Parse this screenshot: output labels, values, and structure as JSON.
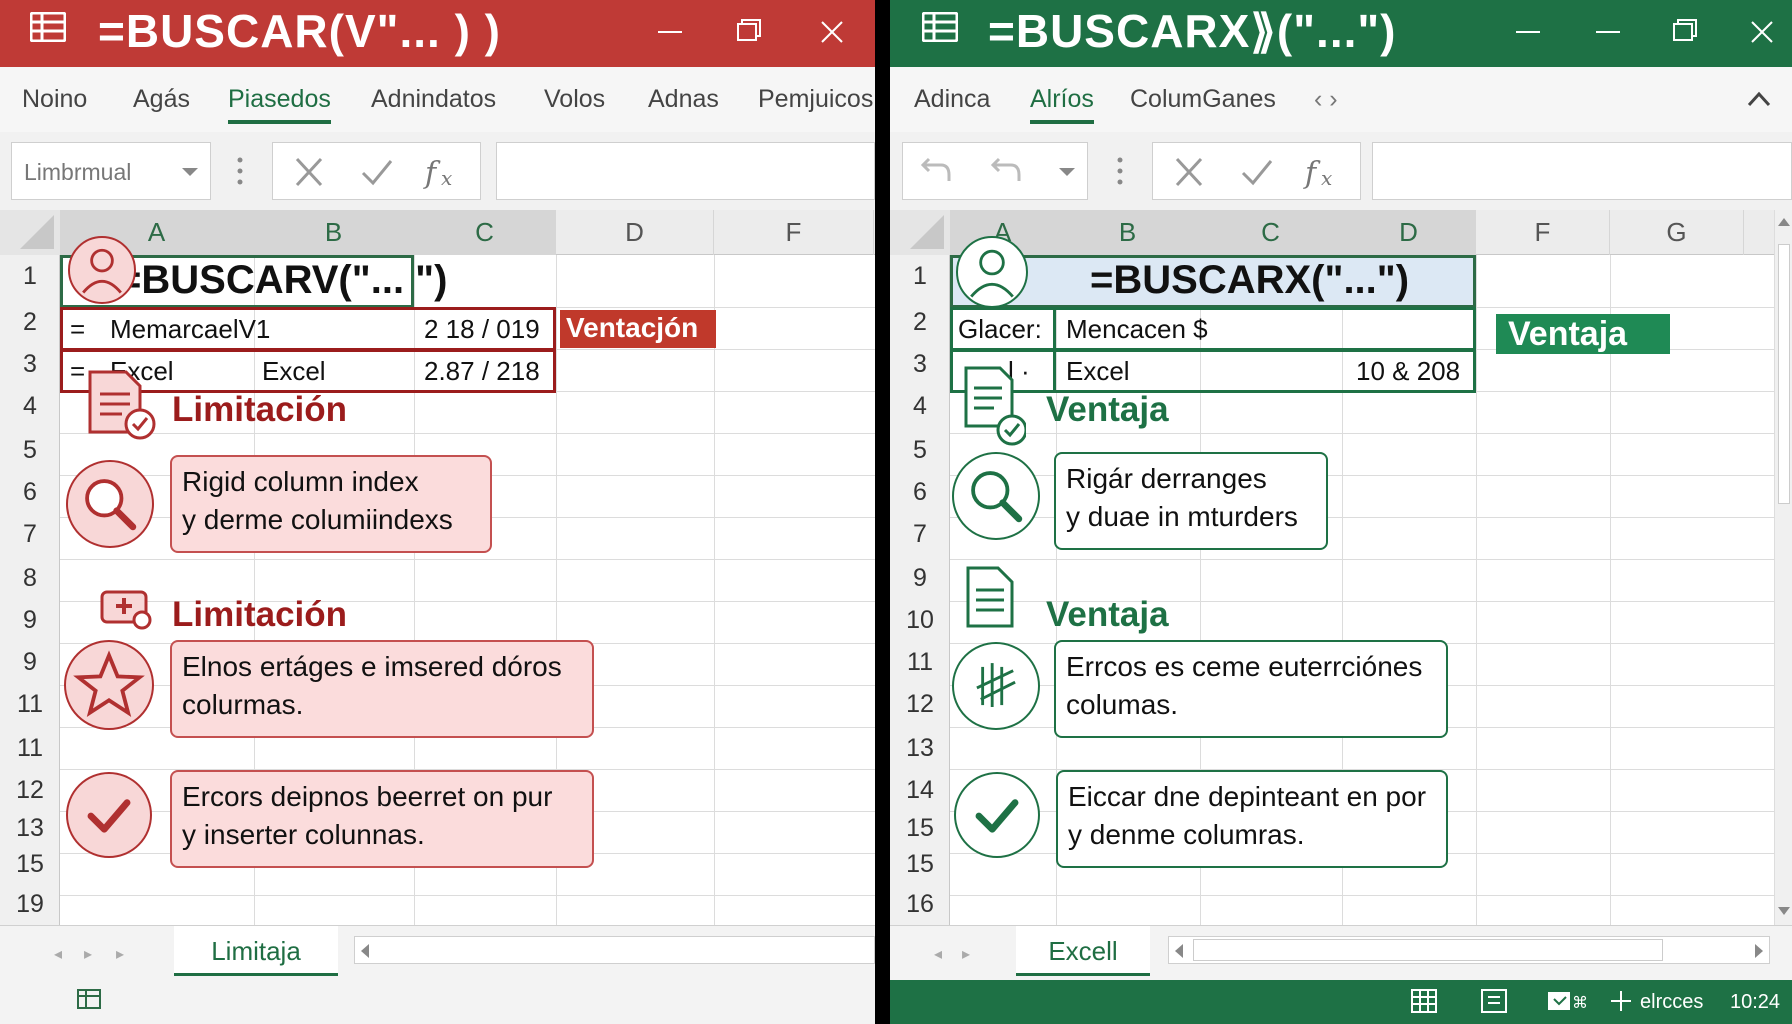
{
  "left": {
    "title": "=BUSCAR(V\"... ) )",
    "tabs": [
      "Noino",
      "Agás",
      "Piasedos",
      "Adnindatos",
      "Volos",
      "Adnas",
      "Pemjuicos"
    ],
    "active_tab": "Piasedos",
    "name_box": "Limbrmual",
    "columns": [
      "A",
      "B",
      "C",
      "D",
      "F"
    ],
    "rows": [
      "1",
      "2",
      "3",
      "4",
      "5",
      "6",
      "7",
      "8",
      "9",
      "9",
      "11",
      "11",
      "12",
      "13",
      "15",
      "19"
    ],
    "formula_cell": "=BUSCARV(\"... \")",
    "r2": {
      "a": "=",
      "b": "MemarcaelV1",
      "c": "2 18 / 019"
    },
    "r3": {
      "a": "=",
      "b": "Excel",
      "b2": "Excel",
      "c": "2.87 / 218"
    },
    "tag": "Ventacjón",
    "heading1": "Limitación",
    "heading2": "Limitación",
    "card1": [
      "Rigid column index",
      "y derme columiindexs"
    ],
    "card2": [
      "Elnos ertáges e imsered dóros",
      "colurmas."
    ],
    "card3": [
      "Ercors deipnos beerret on pur",
      "y inserter colunnas."
    ],
    "sheet_tab": "Limitaja",
    "accent": "#bf3a36"
  },
  "right": {
    "title": "=BUSCARX⟫(\"...\")",
    "tabs": [
      "Adinca",
      "Alríos",
      "ColumGanes",
      "‹ ›"
    ],
    "active_tab": "Alríos",
    "columns": [
      "A",
      "B",
      "C",
      "D",
      "F",
      "G"
    ],
    "rows": [
      "1",
      "2",
      "3",
      "4",
      "5",
      "6",
      "7",
      "9",
      "10",
      "11",
      "12",
      "13",
      "14",
      "15",
      "15",
      "16"
    ],
    "formula_cell": "=BUSCARX(\"...\")",
    "r2": {
      "a": "Glacer:",
      "b": "Mencacen $"
    },
    "r3": {
      "a": "l  ·",
      "b": "Excel",
      "d": "10 & 208"
    },
    "tag": "Ventaja",
    "heading1": "Ventaja",
    "heading2": "Ventaja",
    "card1": [
      "Rigár derranges",
      "y duae in mturders"
    ],
    "card2": [
      "Errcos es ceme euterrciónes",
      "columas."
    ],
    "card3": [
      "Eiccar dne depinteant en por",
      "y denme columras."
    ],
    "sheet_tab": "Excell",
    "status_text": "elrcces",
    "clock": "10:24",
    "accent": "#1e7145"
  }
}
